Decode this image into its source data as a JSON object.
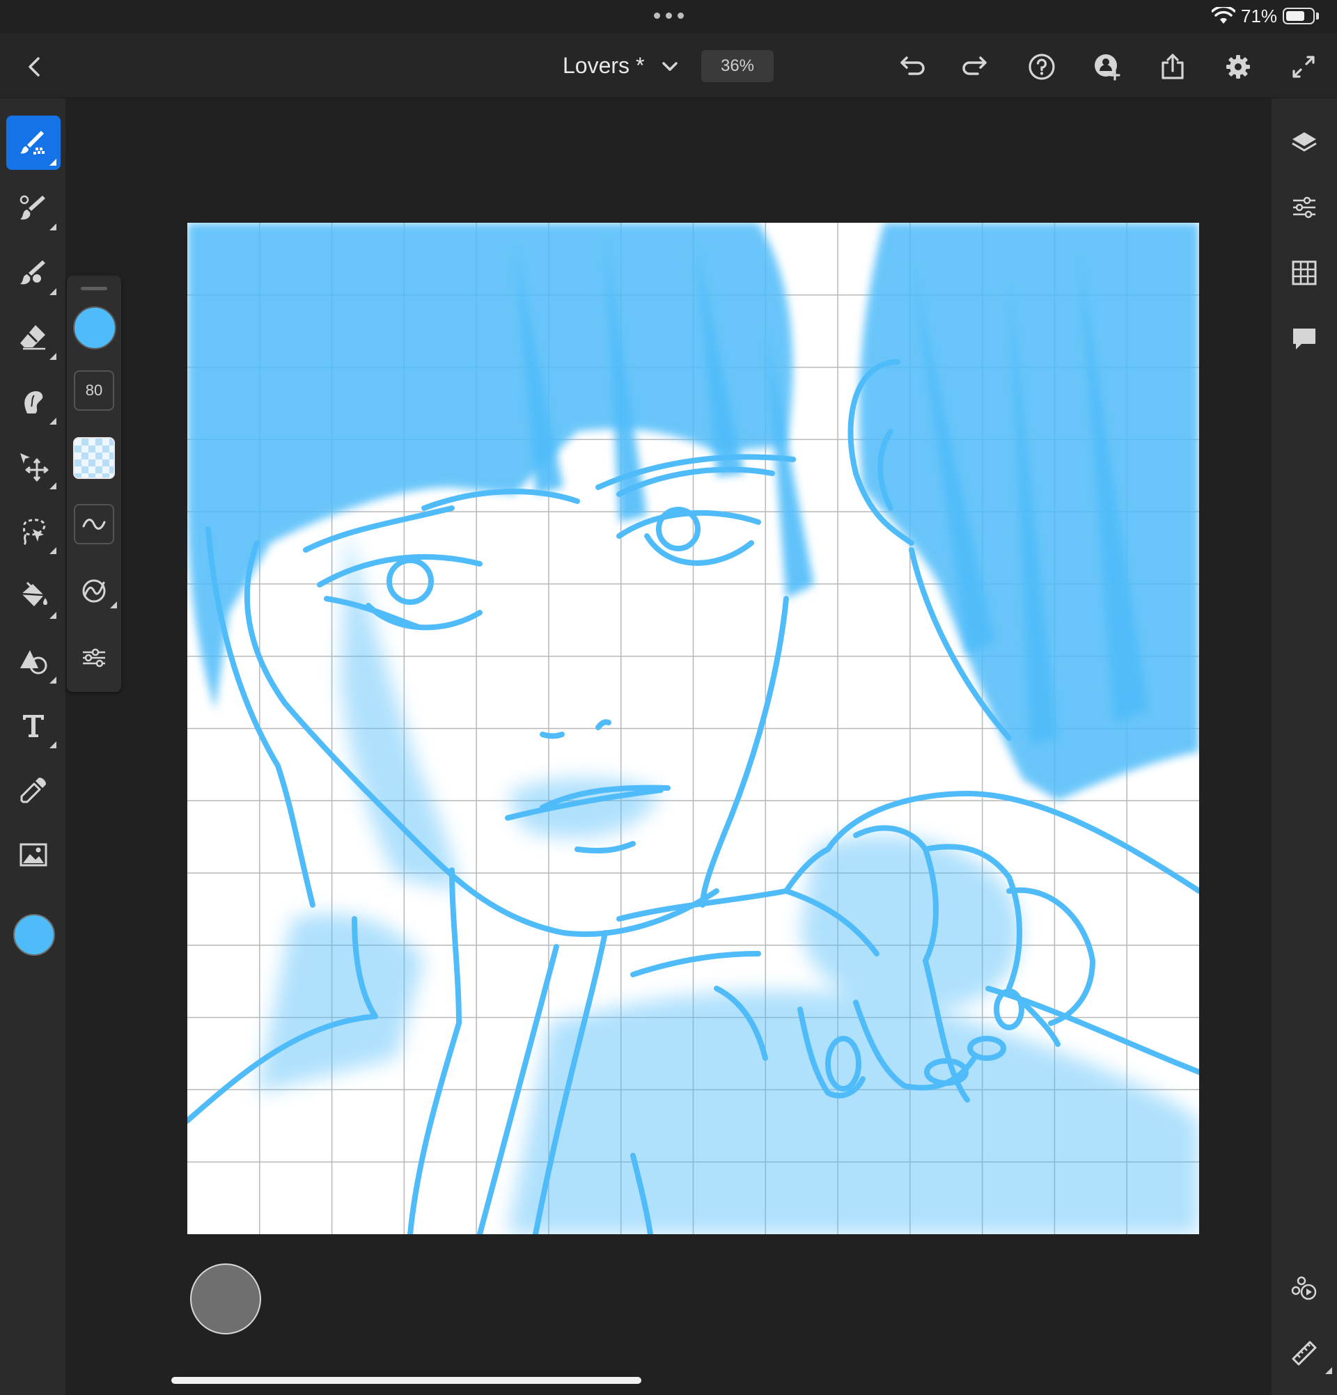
{
  "status_bar": {
    "battery_percent": "71%",
    "battery_level": 0.71,
    "icons": [
      "multitask-dots-icon",
      "wifi-icon",
      "battery-icon"
    ]
  },
  "top_bar": {
    "document_title": "Lovers *",
    "zoom": "36%",
    "icons": [
      "back-chevron-icon",
      "title-dropdown-chevron-icon",
      "undo-icon",
      "redo-icon",
      "help-icon",
      "invite-user-icon",
      "share-icon",
      "settings-gear-icon",
      "fullscreen-icon"
    ]
  },
  "left_toolbar": {
    "tools": [
      {
        "name": "pixel-brush",
        "icon": "pixel-brush-icon",
        "active": true
      },
      {
        "name": "live-brush",
        "icon": "live-brush-icon",
        "active": false
      },
      {
        "name": "vector-brush",
        "icon": "vector-brush-icon",
        "active": false
      },
      {
        "name": "eraser",
        "icon": "eraser-icon",
        "active": false
      },
      {
        "name": "smudge",
        "icon": "smudge-icon",
        "active": false
      },
      {
        "name": "transform",
        "icon": "transform-move-icon",
        "active": false
      },
      {
        "name": "selection",
        "icon": "lasso-selection-icon",
        "active": false
      },
      {
        "name": "fill",
        "icon": "paint-bucket-icon",
        "active": false
      },
      {
        "name": "shape",
        "icon": "shape-icon",
        "active": false
      },
      {
        "name": "text",
        "icon": "text-icon",
        "active": false
      },
      {
        "name": "eyedropper",
        "icon": "eyedropper-icon",
        "active": false
      },
      {
        "name": "place-image",
        "icon": "image-icon",
        "active": false
      }
    ],
    "current_color": "#4fbcf9"
  },
  "brush_panel": {
    "color": "#4fbcf9",
    "size": "80",
    "icons": [
      "opacity-swatch-icon",
      "smoothing-wave-icon",
      "brush-dynamics-icon",
      "brush-settings-sliders-icon"
    ]
  },
  "right_panel": {
    "icons": [
      "layers-icon",
      "layer-properties-icon",
      "grid-icon",
      "comments-icon",
      "timelapse-icon",
      "ruler-icon"
    ]
  },
  "canvas": {
    "background": "#ffffff",
    "stroke_color": "#4fbcf9",
    "grid": true,
    "grid_divisions": 14
  },
  "colors": {
    "accent": "#1473e6",
    "app_background": "#212121",
    "panel": "#2b2b2b"
  }
}
